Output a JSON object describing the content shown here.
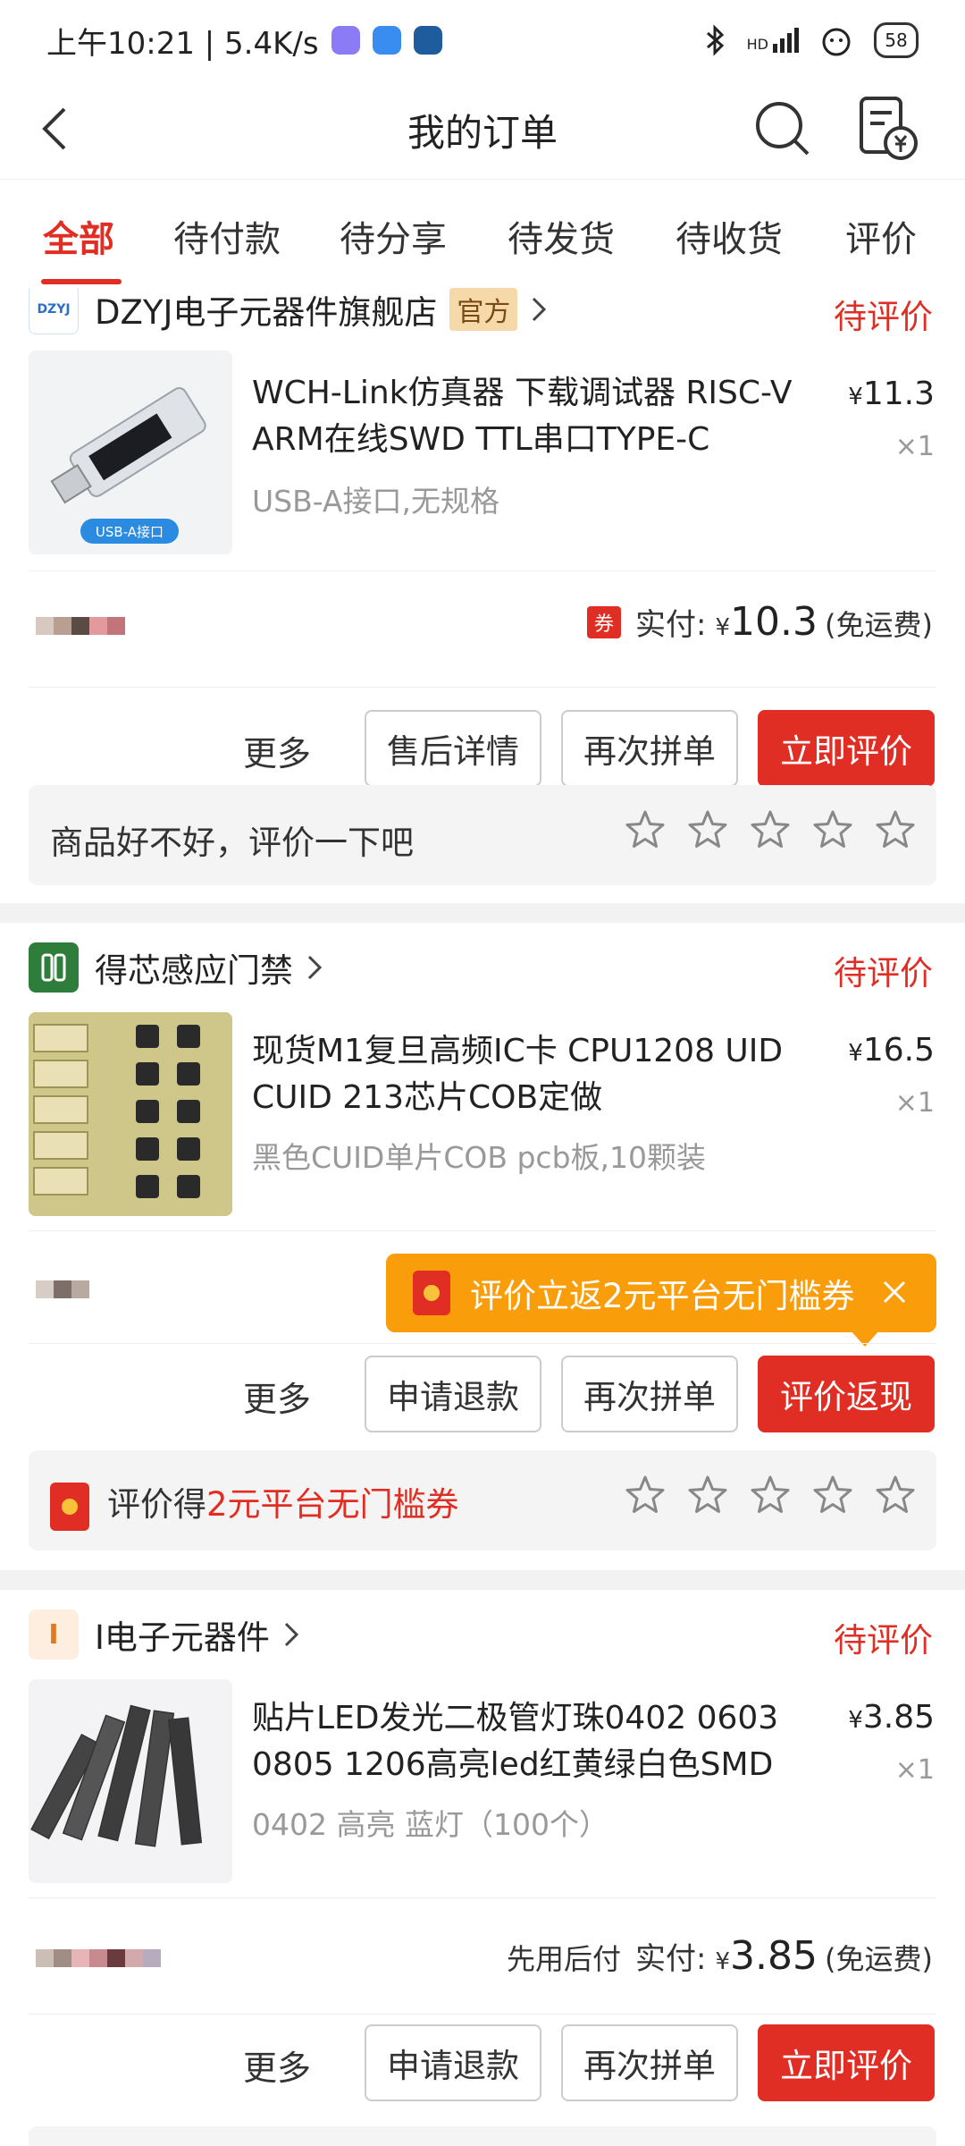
{
  "status_bar": {
    "time_speed": "上午10:21 | 5.4K/s",
    "signal": "HD",
    "battery": "58"
  },
  "nav": {
    "title": "我的订单"
  },
  "tabs": [
    {
      "label": "全部",
      "active": true
    },
    {
      "label": "待付款",
      "active": false
    },
    {
      "label": "待分享",
      "active": false
    },
    {
      "label": "待发货",
      "active": false
    },
    {
      "label": "待收货",
      "active": false
    },
    {
      "label": "评价",
      "active": false
    }
  ],
  "orders": [
    {
      "store": "DZYJ电子元器件旗舰店",
      "store_logo_text": "DZYJ",
      "official_tag": "官方",
      "status": "待评价",
      "title": "WCH-Link仿真器 下载调试器 RISC-V ARM在线SWD TTL串口TYPE-C",
      "spec": "USB-A接口,无规格",
      "thumb_label": "USB-A接口",
      "currency": "¥",
      "price": "11.3",
      "qty": "×1",
      "coupon_chip": "券",
      "paid_label": "实付:",
      "paid_amount": "10.3",
      "shipping": "(免运费)",
      "more": "更多",
      "btn1": "售后详情",
      "btn2": "再次拼单",
      "btn3": "立即评价",
      "rate_prompt": "商品好不好，评价一下吧"
    },
    {
      "store": "得芯感应门禁",
      "status": "待评价",
      "title": "现货M1复旦高频IC卡 CPU1208 UID CUID 213芯片COB定做",
      "spec": "黑色CUID单片COB pcb板,10颗装",
      "currency": "¥",
      "price": "16.5",
      "qty": "×1",
      "tip": "评价立返2元平台无门槛券",
      "more": "更多",
      "btn1": "申请退款",
      "btn2": "再次拼单",
      "btn3": "评价返现",
      "rate_prompt_prefix": "评价得",
      "rate_prompt_highlight": "2元平台无门槛券"
    },
    {
      "store": "I电子元器件",
      "store_logo_text": "I",
      "status": "待评价",
      "title": "贴片LED发光二极管灯珠0402 0603 0805 1206高亮led红黄绿白色SMD",
      "spec": "0402 高亮 蓝灯（100个）",
      "currency": "¥",
      "price": "3.85",
      "qty": "×1",
      "pay_later": "先用后付",
      "paid_label": "实付:",
      "paid_amount": "3.85",
      "shipping": "(免运费)",
      "more": "更多",
      "btn1": "申请退款",
      "btn2": "再次拼单",
      "btn3": "立即评价"
    }
  ],
  "colors": {
    "accent_red": "#e02e24",
    "tip_orange": "#fa9d0a",
    "official_tag_bg": "#f6d9a8"
  }
}
